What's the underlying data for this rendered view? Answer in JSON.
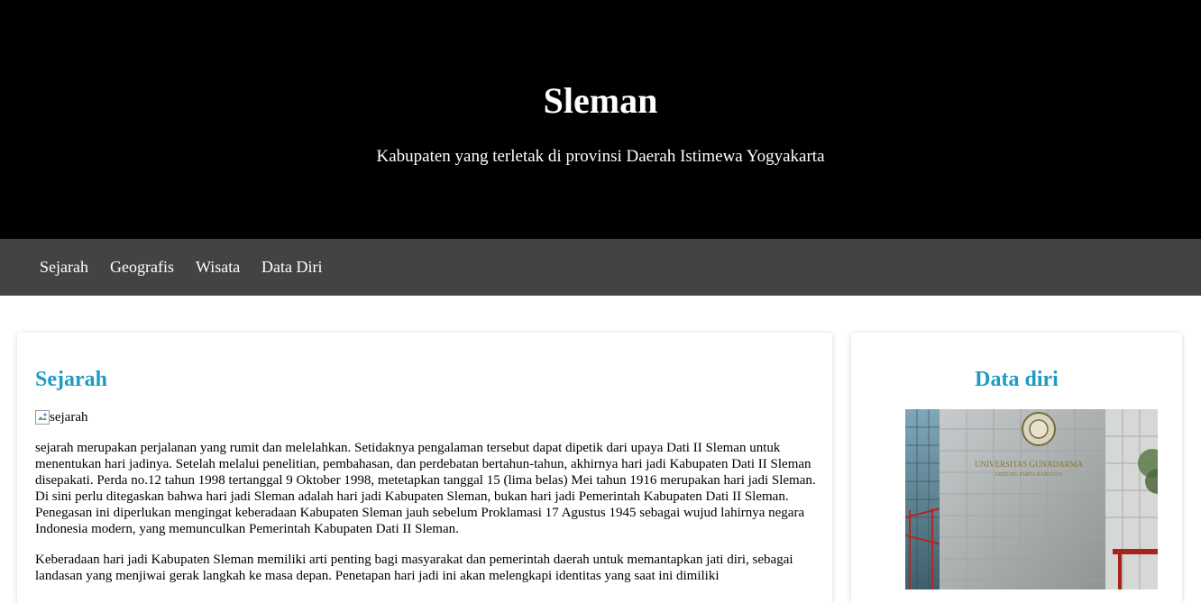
{
  "header": {
    "title": "Sleman",
    "subtitle": "Kabupaten yang terletak di provinsi Daerah Istimewa Yogyakarta"
  },
  "nav": {
    "items": [
      {
        "label": "Sejarah"
      },
      {
        "label": "Geografis"
      },
      {
        "label": "Wisata"
      },
      {
        "label": "Data Diri"
      }
    ]
  },
  "main": {
    "heading": "Sejarah",
    "image_alt": "sejarah",
    "paragraphs": [
      "sejarah merupakan perjalanan yang rumit dan melelahkan. Setidaknya pengalaman tersebut dapat dipetik dari upaya Dati II Sleman untuk menentukan hari jadinya. Setelah melalui penelitian, pembahasan, dan perdebatan bertahun-tahun, akhirnya hari jadi Kabupaten Dati II Sleman disepakati. Perda no.12 tahun 1998 tertanggal 9 Oktober 1998, metetapkan tanggal 15 (lima belas) Mei tahun 1916 merupakan hari jadi Sleman. Di sini perlu ditegaskan bahwa hari jadi Sleman adalah hari jadi Kabupaten Sleman, bukan hari jadi Pemerintah Kabupaten Dati II Sleman. Penegasan ini diperlukan mengingat keberadaan Kabupaten Sleman jauh sebelum Proklamasi 17 Agustus 1945 sebagai wujud lahirnya negara Indonesia modern, yang memunculkan Pemerintah Kabupaten Dati II Sleman.",
      "Keberadaan hari jadi Kabupaten Sleman memiliki arti penting bagi masyarakat dan pemerintah daerah untuk memantapkan jati diri, sebagai landasan yang menjiwai gerak langkah ke masa depan. Penetapan hari jadi ini akan melengkapi identitas yang saat ini dimiliki"
    ]
  },
  "sidebar": {
    "heading": "Data diri",
    "photo": {
      "sign_line1": "UNIVERSITAS GUNADARMA",
      "sign_line2": "GEDUNG PARTA KARTANA"
    }
  }
}
